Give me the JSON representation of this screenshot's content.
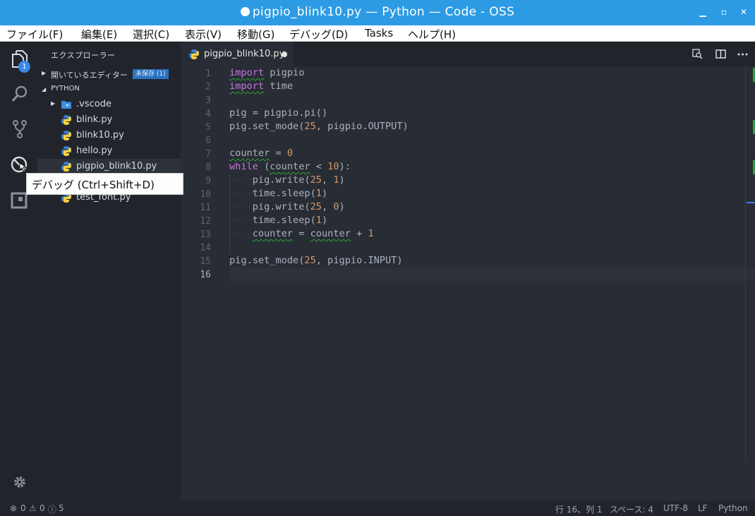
{
  "window": {
    "title": "pigpio_blink10.py — Python — Code - OSS",
    "minimize_glyph": "▁",
    "maximize_glyph": "▫",
    "close_glyph": "✕"
  },
  "menu": [
    "ファイル(F)",
    "編集(E)",
    "選択(C)",
    "表示(V)",
    "移動(G)",
    "デバッグ(D)",
    "Tasks",
    "ヘルプ(H)"
  ],
  "activity": {
    "explorer_badge": "1",
    "icons": [
      "files-icon",
      "search-icon",
      "source-control-icon",
      "debug-icon",
      "extensions-icon",
      "gear-icon"
    ]
  },
  "sidebar": {
    "header": "エクスプローラー",
    "open_editors": {
      "label": "開いているエディター",
      "unsaved": "未保存 (1)"
    },
    "folder": "PYTHON",
    "files": [
      ".vscode",
      "blink.py",
      "blink10.py",
      "hello.py",
      "pigpio_blink10.py",
      "test_font.py"
    ]
  },
  "tooltip": "デバッグ (Ctrl+Shift+D)",
  "tab": {
    "name": "pigpio_blink10.py"
  },
  "editor": {
    "line_numbers": [
      "1",
      "2",
      "3",
      "4",
      "5",
      "6",
      "7",
      "8",
      "9",
      "10",
      "11",
      "12",
      "13",
      "14",
      "15",
      "16"
    ],
    "lines": [
      "import pigpio",
      "import time",
      "",
      "pig = pigpio.pi()",
      "pig.set_mode(25, pigpio.OUTPUT)",
      "",
      "counter = 0",
      "while (counter < 10):",
      "····pig.write(25, 1)",
      "····time.sleep(1)",
      "····pig.write(25, 0)",
      "····time.sleep(1)",
      "····counter = counter + 1",
      "",
      "pig.set_mode(25, pigpio.INPUT)",
      ""
    ]
  },
  "status": {
    "errors": "0",
    "warnings": "0",
    "info": "5",
    "position": "行 16、列 1",
    "spaces": "スペース: 4",
    "encoding": "UTF-8",
    "eol": "LF",
    "language": "Python"
  }
}
